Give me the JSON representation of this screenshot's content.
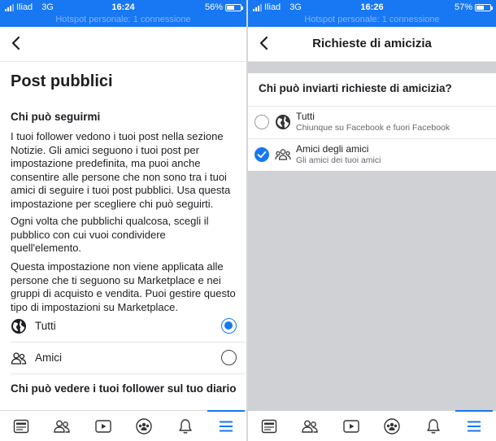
{
  "colors": {
    "accent": "#1877f2",
    "gray_area": "#d0d1d5"
  },
  "left": {
    "status": {
      "carrier": "Iliad",
      "network": "3G",
      "time": "16:24",
      "battery": "56%",
      "battery_level": 0.56,
      "hotspot": "Hotspot personale: 1 connessione"
    },
    "page_title": "Post pubblici",
    "section1_title": "Chi può seguirmi",
    "para1": "I tuoi follower vedono i tuoi post nella sezione Notizie. Gli amici seguono i tuoi post per impostazione predefinita, ma puoi anche consentire alle persone che non sono tra i tuoi amici di seguire i tuoi post pubblici. Usa questa impostazione per scegliere chi può seguirti.",
    "para2": "Ogni volta che pubblichi qualcosa, scegli il pubblico con cui vuoi condividere quell'elemento.",
    "para3": "Questa impostazione non viene applicata alle persone che ti seguono su Marketplace e nei gruppi di acquisto e vendita. Puoi gestire questo tipo di impostazioni su Marketplace.",
    "options": [
      {
        "label": "Tutti",
        "icon": "globe-icon",
        "selected": true
      },
      {
        "label": "Amici",
        "icon": "friends-icon",
        "selected": false
      }
    ],
    "section2_title": "Chi può vedere i tuoi follower sul tuo diario"
  },
  "right": {
    "status": {
      "carrier": "Iliad",
      "network": "3G",
      "time": "16:26",
      "battery": "57%",
      "battery_level": 0.57,
      "hotspot": "Hotspot personale: 1 connessione"
    },
    "header_title": "Richieste di amicizia",
    "question": "Chi può inviarti richieste di amicizia?",
    "options": [
      {
        "label": "Tutti",
        "sublabel": "Chiunque su Facebook e fuori Facebook",
        "icon": "globe-icon",
        "selected": false
      },
      {
        "label": "Amici degli amici",
        "sublabel": "Gli amici dei tuoi amici",
        "icon": "friends-icon",
        "selected": true
      }
    ]
  },
  "tabs": [
    "news-feed-icon",
    "friends-icon",
    "watch-icon",
    "groups-icon",
    "notifications-icon",
    "menu-icon"
  ],
  "active_tab": "menu-icon"
}
